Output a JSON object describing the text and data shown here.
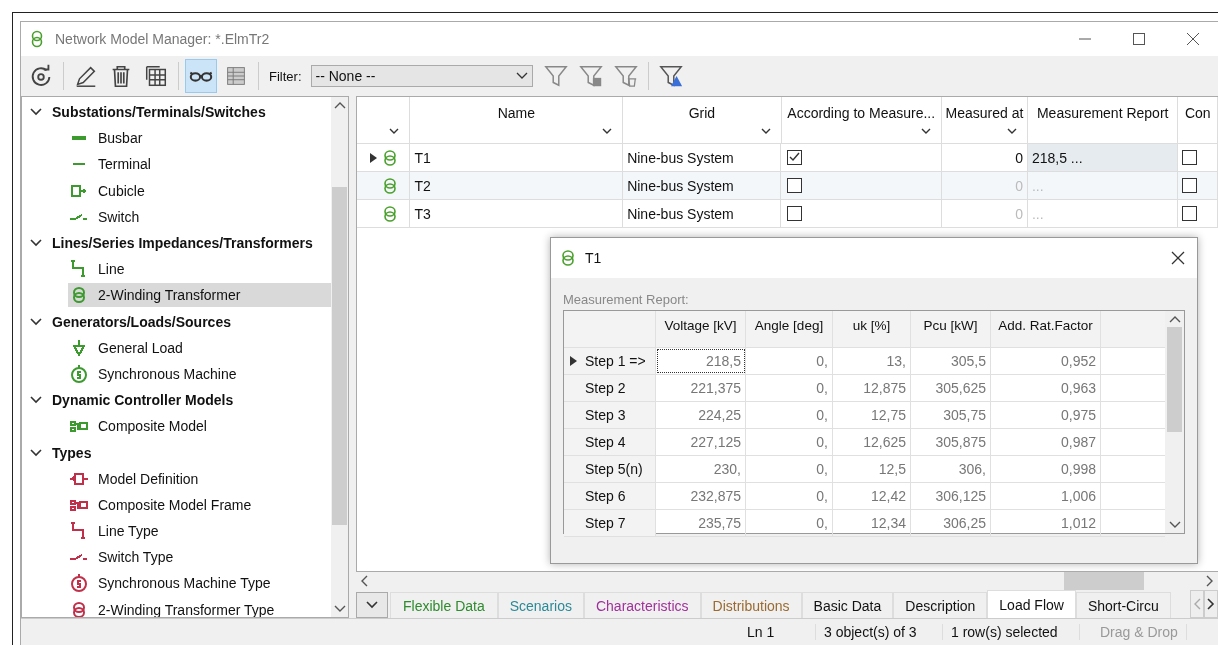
{
  "window": {
    "title": "Network Model Manager: *.ElmTr2"
  },
  "toolbar": {
    "buttons": [
      {
        "kind": "refresh",
        "selected": false
      },
      {
        "kind": "edit",
        "selected": false
      },
      {
        "kind": "delete",
        "selected": false
      },
      {
        "kind": "grid",
        "selected": false
      },
      {
        "kind": "glasses",
        "selected": true
      },
      {
        "kind": "table",
        "selected": false
      }
    ],
    "filter_label": "Filter:",
    "filter_value": "-- None --",
    "filter_buttons": [
      {
        "kind": "filter"
      },
      {
        "kind": "filter-save"
      },
      {
        "kind": "filter-delete"
      },
      {
        "kind": "filter-warning"
      }
    ]
  },
  "tree": [
    {
      "label": "Substations/Terminals/Switches",
      "expanded": true,
      "children": [
        {
          "label": "Busbar",
          "kind": "busbar",
          "color": "#3d9a2e",
          "selected": false
        },
        {
          "label": "Terminal",
          "kind": "terminal",
          "color": "#3d9a2e",
          "selected": false
        },
        {
          "label": "Cubicle",
          "kind": "cubicle",
          "color": "#3d9a2e",
          "selected": false
        },
        {
          "label": "Switch",
          "kind": "switch",
          "color": "#3d9a2e",
          "selected": false
        }
      ]
    },
    {
      "label": "Lines/Series Impedances/Transformers",
      "expanded": true,
      "children": [
        {
          "label": "Line",
          "kind": "line",
          "color": "#3d9a2e",
          "selected": false
        },
        {
          "label": "2-Winding Transformer",
          "kind": "transformer",
          "color": "#3d9a2e",
          "selected": true
        }
      ]
    },
    {
      "label": "Generators/Loads/Sources",
      "expanded": true,
      "children": [
        {
          "label": "General Load",
          "kind": "load",
          "color": "#3d9a2e",
          "selected": false
        },
        {
          "label": "Synchronous Machine",
          "kind": "machine",
          "color": "#3d9a2e",
          "selected": false
        }
      ]
    },
    {
      "label": "Dynamic Controller Models",
      "expanded": true,
      "children": [
        {
          "label": "Composite Model",
          "kind": "composite",
          "color": "#3d9a2e",
          "selected": false
        }
      ]
    },
    {
      "label": "Types",
      "expanded": true,
      "children": [
        {
          "label": "Model Definition",
          "kind": "definition",
          "color": "#c0304a",
          "selected": false
        },
        {
          "label": "Composite Model Frame",
          "kind": "composite",
          "color": "#c0304a",
          "selected": false
        },
        {
          "label": "Line Type",
          "kind": "line",
          "color": "#c0304a",
          "selected": false
        },
        {
          "label": "Switch Type",
          "kind": "switch",
          "color": "#c0304a",
          "selected": false
        },
        {
          "label": "Synchronous Machine Type",
          "kind": "machine",
          "color": "#c0304a",
          "selected": false
        },
        {
          "label": "2-Winding Transformer Type",
          "kind": "transformer",
          "color": "#c0304a",
          "selected": false
        }
      ]
    }
  ],
  "table": {
    "columns": [
      {
        "filter_arrow": true
      },
      {
        "label": "Name",
        "filter_arrow": true
      },
      {
        "label": "Grid",
        "filter_arrow": true
      },
      {
        "label": "According to Measure...",
        "filter_arrow": true
      },
      {
        "label": "Measured at",
        "filter_arrow": true
      },
      {
        "label": "Measurement Report",
        "filter_arrow": false
      },
      {
        "label": "Con",
        "filter_arrow": false
      }
    ],
    "rows": [
      {
        "current": true,
        "selected": true,
        "name": "T1",
        "grid": "Nine-bus System",
        "according": true,
        "measured_at": "0",
        "report": "218,5 ...",
        "con": false
      },
      {
        "current": false,
        "selected": false,
        "name": "T2",
        "grid": "Nine-bus System",
        "according": false,
        "measured_at": "0",
        "report": "...",
        "con": false
      },
      {
        "current": false,
        "selected": false,
        "name": "T3",
        "grid": "Nine-bus System",
        "according": false,
        "measured_at": "0",
        "report": "...",
        "con": false
      }
    ]
  },
  "dialog": {
    "title": "T1",
    "label": "Measurement Report:",
    "columns": [
      "Voltage [kV]",
      "Angle [deg]",
      "uk [%]",
      "Pcu [kW]",
      "Add. Rat.Factor"
    ],
    "rows": [
      {
        "step": "Step 1 =>",
        "current": true,
        "values": [
          "218,5",
          "0,",
          "13,",
          "305,5",
          "0,952"
        ]
      },
      {
        "step": "Step 2",
        "current": false,
        "values": [
          "221,375",
          "0,",
          "12,875",
          "305,625",
          "0,963"
        ]
      },
      {
        "step": "Step 3",
        "current": false,
        "values": [
          "224,25",
          "0,",
          "12,75",
          "305,75",
          "0,975"
        ]
      },
      {
        "step": "Step 4",
        "current": false,
        "values": [
          "227,125",
          "0,",
          "12,625",
          "305,875",
          "0,987"
        ]
      },
      {
        "step": "Step 5(n)",
        "current": false,
        "values": [
          "230,",
          "0,",
          "12,5",
          "306,",
          "0,998"
        ]
      },
      {
        "step": "Step 6",
        "current": false,
        "values": [
          "232,875",
          "0,",
          "12,42",
          "306,125",
          "1,006"
        ]
      },
      {
        "step": "Step 7",
        "current": false,
        "values": [
          "235,75",
          "0,",
          "12,34",
          "306,25",
          "1,012"
        ]
      }
    ]
  },
  "tabs": [
    {
      "label": "Flexible Data",
      "color": "#2e8b2e",
      "selected": false
    },
    {
      "label": "Scenarios",
      "color": "#2a8a96",
      "selected": false
    },
    {
      "label": "Characteristics",
      "color": "#a0309a",
      "selected": false
    },
    {
      "label": "Distributions",
      "color": "#9a6a30",
      "selected": false
    },
    {
      "label": "Basic Data",
      "color": "#111111",
      "selected": false
    },
    {
      "label": "Description",
      "color": "#111111",
      "selected": false
    },
    {
      "label": "Load Flow",
      "color": "#111111",
      "selected": true
    },
    {
      "label": "Short-Circu",
      "color": "#111111",
      "selected": false
    }
  ],
  "status_bar": [
    {
      "text": "Ln 1",
      "disabled": false
    },
    {
      "text": "3 object(s) of 3",
      "disabled": false
    },
    {
      "text": "1 row(s) selected",
      "disabled": false
    },
    {
      "text": "Drag & Drop",
      "disabled": true
    }
  ]
}
